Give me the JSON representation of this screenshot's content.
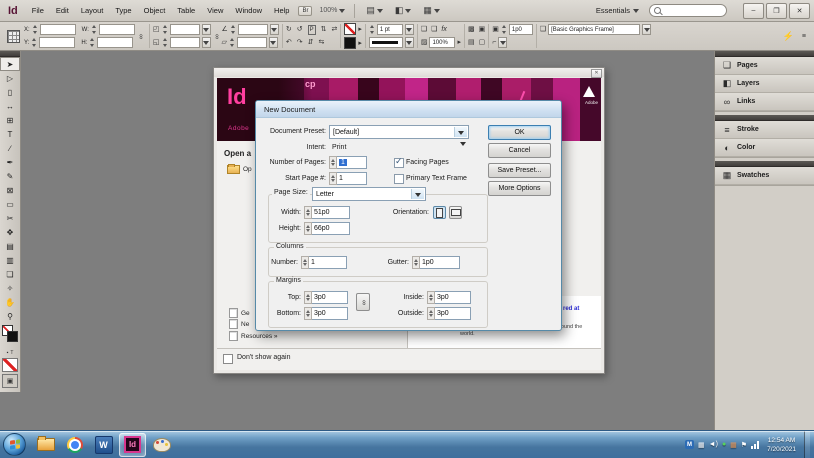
{
  "app": {
    "logo": "Id",
    "menus": [
      "File",
      "Edit",
      "Layout",
      "Type",
      "Object",
      "Table",
      "View",
      "Window",
      "Help"
    ],
    "bridge_label": "Br",
    "zoom_level": "100%",
    "view_icons": [
      "▤",
      "◧",
      "▦"
    ],
    "workspace": "Essentials",
    "window_buttons": {
      "minimize": "–",
      "restore": "❐",
      "close": "✕"
    }
  },
  "control_panel": {
    "x_label": "X:",
    "y_label": "Y:",
    "w_label": "W:",
    "h_label": "H:",
    "stroke_weight": "1 pt",
    "opacity": "100%",
    "corner_radius": "1p0",
    "object_style": "[Basic Graphics Frame]",
    "fx_label": "fx",
    "p_label": "P",
    "quick_apply_glyph": "⚡",
    "panel_menu_glyph": "≡"
  },
  "tools": {
    "items": [
      {
        "name": "Selection",
        "glyph": "➤"
      },
      {
        "name": "Direct Selection",
        "glyph": "▷"
      },
      {
        "name": "Page",
        "glyph": "▯"
      },
      {
        "name": "Gap",
        "glyph": "↔"
      },
      {
        "name": "Content Collector",
        "glyph": "⊞"
      },
      {
        "name": "Type",
        "glyph": "T"
      },
      {
        "name": "Line",
        "glyph": "∕"
      },
      {
        "name": "Pen",
        "glyph": "✒"
      },
      {
        "name": "Pencil",
        "glyph": "✎"
      },
      {
        "name": "Frame",
        "glyph": "⊠"
      },
      {
        "name": "Rectangle",
        "glyph": "▭"
      },
      {
        "name": "Scissors",
        "glyph": "✂"
      },
      {
        "name": "Free Transform",
        "glyph": "✥"
      },
      {
        "name": "Gradient Swatch",
        "glyph": "▤"
      },
      {
        "name": "Gradient Feather",
        "glyph": "▥"
      },
      {
        "name": "Note",
        "glyph": "❏"
      },
      {
        "name": "Eyedropper",
        "glyph": "✧"
      },
      {
        "name": "Hand",
        "glyph": "✋"
      },
      {
        "name": "Zoom",
        "glyph": "⚲"
      }
    ]
  },
  "dock": {
    "panels": [
      {
        "label": "Pages",
        "glyph": "❑"
      },
      {
        "label": "Layers",
        "glyph": "◧"
      },
      {
        "label": "Links",
        "glyph": "∞"
      },
      {
        "label": "Stroke",
        "glyph": "≡"
      },
      {
        "label": "Color",
        "glyph": "◐"
      },
      {
        "label": "Swatches",
        "glyph": "▦"
      }
    ]
  },
  "welcome": {
    "close": "✕",
    "banner": {
      "logo": "Id",
      "brand": "Adobe",
      "collage_text": "cp",
      "adobe_small": "Adobe"
    },
    "open_heading": "Open a",
    "open_item": "Op",
    "list_items": [
      "Ge",
      "Ne",
      "Resources »"
    ],
    "link_fragment": "red at",
    "event_text": "s and labs led by expert speakers from around the world.",
    "dont_show_label": "Don't show again"
  },
  "dialog": {
    "title": "New Document",
    "preset_label": "Document Preset:",
    "preset_value": "[Default]",
    "intent_label": "Intent:",
    "intent_value": "Print",
    "pages_label": "Number of Pages:",
    "pages_value": "1",
    "facing_label": "Facing Pages",
    "check_glyph": "✓",
    "start_label": "Start Page #:",
    "start_value": "1",
    "primary_label": "Primary Text Frame",
    "page_size_label": "Page Size:",
    "page_size_value": "Letter",
    "width_label": "Width:",
    "width_value": "51p0",
    "height_label": "Height:",
    "height_value": "66p0",
    "orientation_label": "Orientation:",
    "columns_legend": "Columns",
    "number_label": "Number:",
    "number_value": "1",
    "gutter_label": "Gutter:",
    "gutter_value": "1p0",
    "margins_legend": "Margins",
    "top_label": "Top:",
    "top_value": "3p0",
    "bottom_label": "Bottom:",
    "bottom_value": "3p0",
    "inside_label": "Inside:",
    "inside_value": "3p0",
    "outside_label": "Outside:",
    "outside_value": "3p0",
    "ok_label": "OK",
    "cancel_label": "Cancel",
    "save_preset_label": "Save Preset...",
    "more_options_label": "More Options"
  },
  "taskbar": {
    "word_label": "W",
    "indesign_label": "Id",
    "tray_m": "M",
    "tray_flag": "⚑",
    "speaker_glyph": "◄)",
    "clock_time": "12:54 AM",
    "clock_date": "7/20/2021"
  }
}
